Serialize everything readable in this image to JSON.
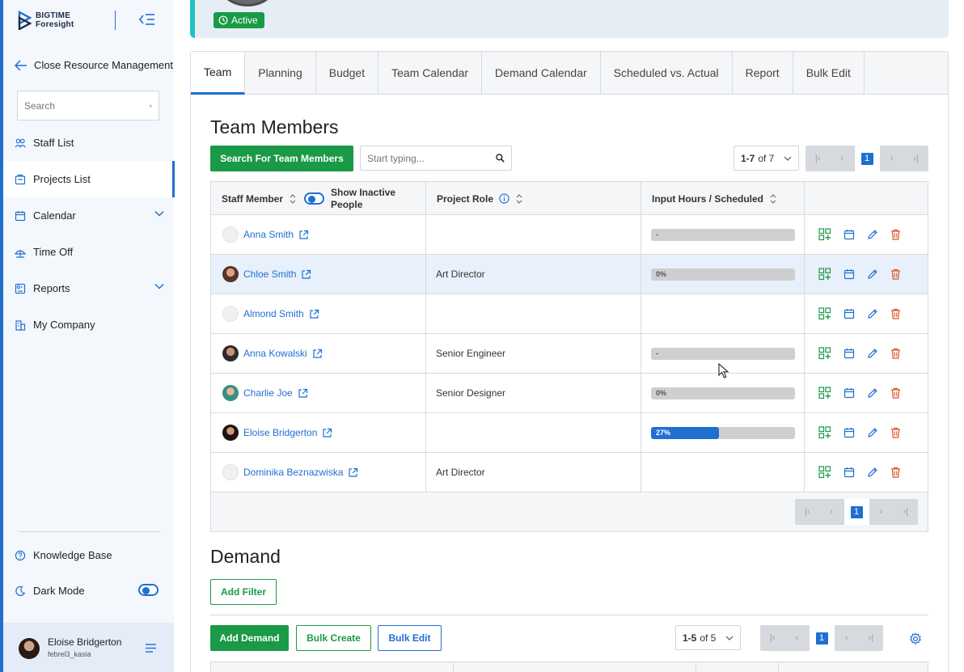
{
  "brand": {
    "line1": "BIGTIME",
    "line2": "Foresight"
  },
  "sidebar": {
    "back_label": "Close Resource Management",
    "search_placeholder": "Search",
    "items": [
      {
        "label": "Staff List",
        "icon": "users-icon"
      },
      {
        "label": "Projects List",
        "icon": "projects-icon",
        "active": true
      },
      {
        "label": "Calendar",
        "icon": "calendar-icon",
        "expandable": true
      },
      {
        "label": "Time Off",
        "icon": "time-off-icon"
      },
      {
        "label": "Reports",
        "icon": "reports-icon",
        "expandable": true
      },
      {
        "label": "My Company",
        "icon": "company-icon"
      }
    ],
    "knowledge_base": "Knowledge Base",
    "dark_mode": "Dark Mode",
    "user": {
      "name": "Eloise Bridgerton",
      "username": "febrel3_kasia"
    }
  },
  "header": {
    "status": "Active"
  },
  "tabs": [
    "Team",
    "Planning",
    "Budget",
    "Team Calendar",
    "Demand Calendar",
    "Scheduled vs. Actual",
    "Report",
    "Bulk Edit"
  ],
  "team": {
    "title": "Team Members",
    "search_button": "Search For Team Members",
    "search_placeholder": "Start typing...",
    "range": {
      "bold": "1-7",
      "rest": "of 7"
    },
    "page": "1",
    "columns": {
      "staff": "Staff Member",
      "show_inactive": "Show Inactive People",
      "role": "Project Role",
      "hours": "Input Hours / Scheduled"
    },
    "rows": [
      {
        "name": "Anna Smith",
        "role": "",
        "progress_label": "-",
        "progress": 0,
        "show_bar": true
      },
      {
        "name": "Chloe Smith",
        "role": "Art Director",
        "progress_label": "0%",
        "progress": 0,
        "show_bar": true
      },
      {
        "name": "Almond Smith",
        "role": "",
        "progress_label": "",
        "progress": 0,
        "show_bar": false
      },
      {
        "name": "Anna Kowalski",
        "role": "Senior Engineer",
        "progress_label": "-",
        "progress": 0,
        "show_bar": true
      },
      {
        "name": "Charlie Joe",
        "role": "Senior Designer",
        "progress_label": "0%",
        "progress": 0,
        "show_bar": true
      },
      {
        "name": "Eloise Bridgerton",
        "role": "",
        "progress_label": "27%",
        "progress": 27,
        "show_bar": true
      },
      {
        "name": "Dominika Beznazwiska",
        "role": "Art Director",
        "progress_label": "",
        "progress": 0,
        "show_bar": false
      }
    ]
  },
  "demand": {
    "title": "Demand",
    "add_filter": "Add Filter",
    "add_demand": "Add Demand",
    "bulk_create": "Bulk Create",
    "bulk_edit": "Bulk Edit",
    "range": {
      "bold": "1-5",
      "rest": "of 5"
    },
    "page": "1"
  },
  "colors": {
    "primary": "#1f6fd1",
    "success": "#1a9a46",
    "danger": "#d9532c",
    "accent": "#1ec2c2"
  }
}
